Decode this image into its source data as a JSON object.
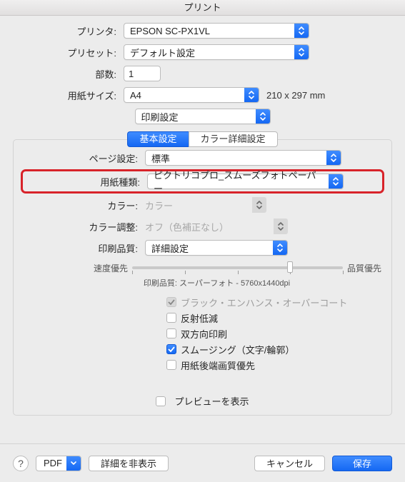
{
  "window": {
    "title": "プリント"
  },
  "labels": {
    "printer": "プリンタ:",
    "preset": "プリセット:",
    "copies": "部数:",
    "paper_size": "用紙サイズ:",
    "page_setup": "ページ設定:",
    "media_type": "用紙種類:",
    "color": "カラー:",
    "color_adjust": "カラー調整:",
    "resolution": "印刷品質:"
  },
  "printer": {
    "value": "EPSON SC-PX1VL"
  },
  "preset": {
    "value": "デフォルト設定"
  },
  "copies": {
    "value": "1"
  },
  "paper_size": {
    "value": "A4",
    "dimensions": "210 x 297 mm"
  },
  "section": {
    "value": "印刷設定"
  },
  "tabs": {
    "basic": "基本設定",
    "color_detail": "カラー詳細設定"
  },
  "page_setup": {
    "value": "標準"
  },
  "media_type": {
    "value": "ピクトリコプロ_スムーズフォトペーパー"
  },
  "color": {
    "value": "カラー"
  },
  "color_adjust": {
    "value": "オフ（色補正なし）"
  },
  "resolution": {
    "value": "詳細設定"
  },
  "slider": {
    "left_label": "速度優先",
    "right_label": "品質優先",
    "ticks": 5,
    "thumb_frac": 0.75
  },
  "quality_line": {
    "prefix": "印刷品質:",
    "value": "スーパーフォト - 5760x1440dpi"
  },
  "checks": {
    "black_enhance": {
      "label": "ブラック・エンハンス・オーバーコート",
      "checked": true,
      "disabled": true
    },
    "reflect": {
      "label": "反射低減",
      "checked": false,
      "disabled": false
    },
    "bidir": {
      "label": "双方向印刷",
      "checked": false,
      "disabled": false
    },
    "smoothing": {
      "label": "スムージング（文字/輪郭）",
      "checked": true,
      "disabled": false
    },
    "trailing_edge": {
      "label": "用紙後端画質優先",
      "checked": false,
      "disabled": false
    }
  },
  "preview_checkbox": {
    "label": "プレビューを表示",
    "checked": false
  },
  "footer": {
    "help": "?",
    "pdf": "PDF",
    "details": "詳細を非表示",
    "cancel": "キャンセル",
    "save": "保存"
  }
}
